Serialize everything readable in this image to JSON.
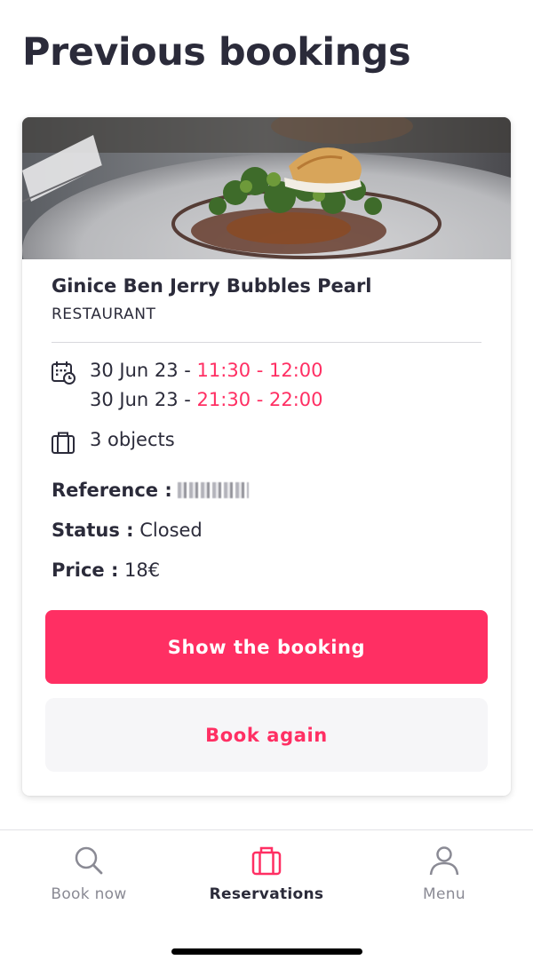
{
  "header": {
    "title": "Previous bookings"
  },
  "booking": {
    "venue_name": "Ginice Ben Jerry Bubbles Pearl",
    "venue_type": "RESTAURANT",
    "slots": [
      {
        "date": "30 Jun 23 - ",
        "time": "11:30 - 12:00"
      },
      {
        "date": "30 Jun 23 - ",
        "time": "21:30 - 22:00"
      }
    ],
    "objects": "3 objects",
    "reference_label": "Reference :",
    "status_label": "Status :",
    "status_value": "Closed",
    "price_label": "Price :",
    "price_value": "18€",
    "show_button": "Show the booking",
    "book_again_button": "Book again"
  },
  "tabbar": {
    "tabs": [
      {
        "label": "Book now",
        "icon": "search-icon"
      },
      {
        "label": "Reservations",
        "icon": "suitcase-icon",
        "active": true
      },
      {
        "label": "Menu",
        "icon": "person-icon"
      }
    ]
  },
  "colors": {
    "accent": "#ff2f63",
    "text": "#2b2b3a",
    "muted": "#8a8a94"
  }
}
